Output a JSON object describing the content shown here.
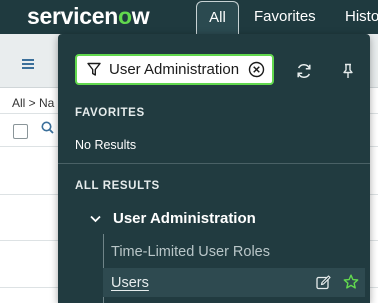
{
  "header": {
    "logo_pre": "servicen",
    "logo_o": "o",
    "logo_post": "w",
    "tabs": [
      {
        "label": "All"
      },
      {
        "label": "Favorites"
      },
      {
        "label": "Histo"
      }
    ]
  },
  "background": {
    "breadcrumb": "All > Na"
  },
  "nav": {
    "filter": {
      "value": "User Administration"
    },
    "favorites": {
      "heading": "FAVORITES",
      "empty_text": "No Results"
    },
    "all_results": {
      "heading": "ALL RESULTS",
      "group": {
        "label": "User Administration",
        "items": [
          {
            "label": "Time-Limited User Roles"
          },
          {
            "label": "Users"
          }
        ]
      }
    },
    "colors": {
      "accent": "#62d84e",
      "panel_bg": "#213b40",
      "header_bg": "#1f3a3f"
    }
  }
}
